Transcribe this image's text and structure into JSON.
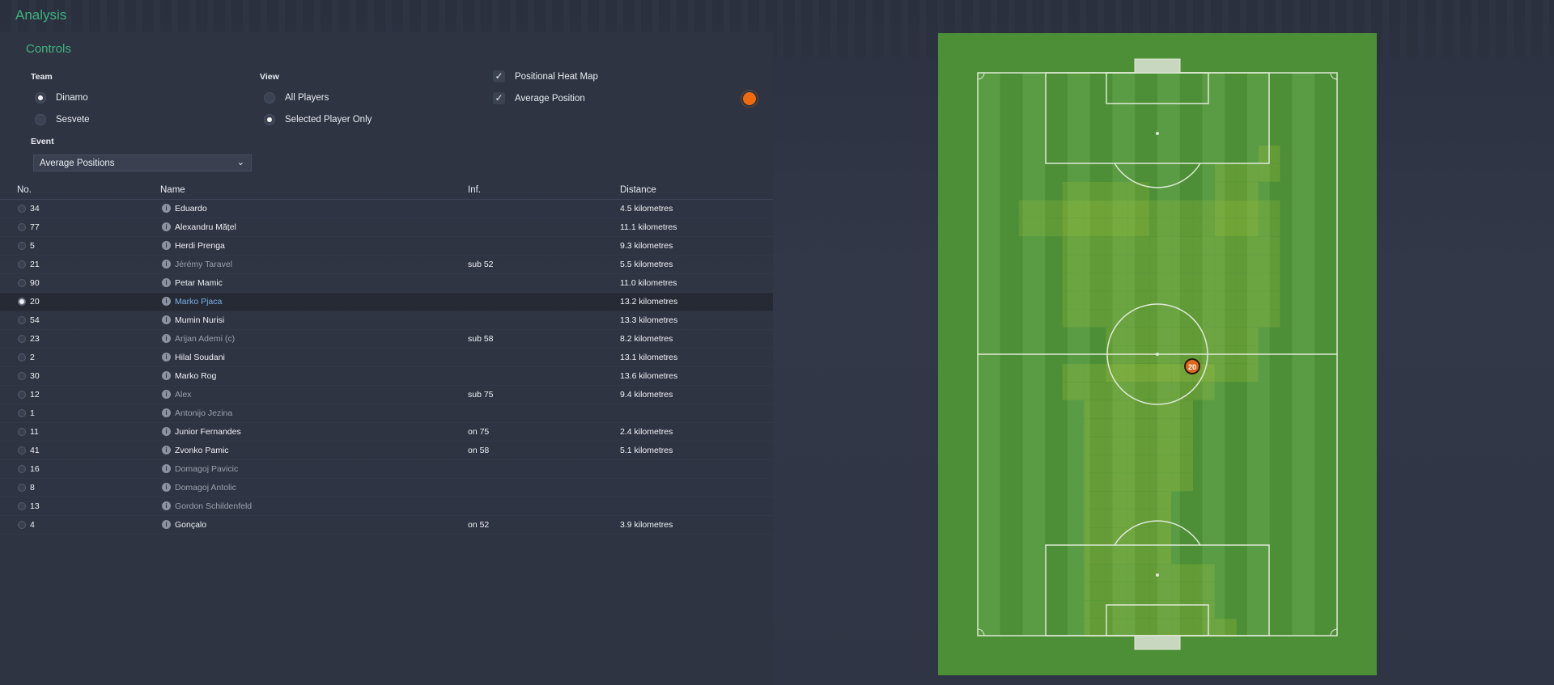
{
  "app_title": "Analysis",
  "controls": {
    "title": "Controls",
    "team_label": "Team",
    "teams": [
      {
        "label": "Dinamo",
        "selected": true
      },
      {
        "label": "Sesvete",
        "selected": false
      }
    ],
    "view_label": "View",
    "views": [
      {
        "label": "All Players",
        "selected": false
      },
      {
        "label": "Selected Player Only",
        "selected": true
      }
    ],
    "options": [
      {
        "label": "Positional Heat Map",
        "checked": true
      },
      {
        "label": "Average Position",
        "checked": true
      }
    ],
    "average_position_color": "#f06a0f",
    "event_label": "Event",
    "event_value": "Average Positions"
  },
  "table": {
    "headers": {
      "no": "No.",
      "name": "Name",
      "inf": "Inf.",
      "distance": "Distance"
    },
    "rows": [
      {
        "no": "34",
        "name": "Eduardo",
        "inf": "",
        "distance": "4.5 kilometres",
        "dim": false,
        "selected": false
      },
      {
        "no": "77",
        "name": "Alexandru Mățel",
        "inf": "",
        "distance": "11.1 kilometres",
        "dim": false,
        "selected": false
      },
      {
        "no": "5",
        "name": "Herdi Prenga",
        "inf": "",
        "distance": "9.3 kilometres",
        "dim": false,
        "selected": false
      },
      {
        "no": "21",
        "name": "Jérémy Taravel",
        "inf": "sub 52",
        "distance": "5.5 kilometres",
        "dim": true,
        "selected": false
      },
      {
        "no": "90",
        "name": "Petar Mamic",
        "inf": "",
        "distance": "11.0 kilometres",
        "dim": false,
        "selected": false
      },
      {
        "no": "20",
        "name": "Marko Pjaca",
        "inf": "",
        "distance": "13.2 kilometres",
        "dim": false,
        "selected": true
      },
      {
        "no": "54",
        "name": "Mumin Nurisi",
        "inf": "",
        "distance": "13.3 kilometres",
        "dim": false,
        "selected": false
      },
      {
        "no": "23",
        "name": "Arijan Ademi (c)",
        "inf": "sub 58",
        "distance": "8.2 kilometres",
        "dim": true,
        "selected": false
      },
      {
        "no": "2",
        "name": "Hilal Soudani",
        "inf": "",
        "distance": "13.1 kilometres",
        "dim": false,
        "selected": false
      },
      {
        "no": "30",
        "name": "Marko Rog",
        "inf": "",
        "distance": "13.6 kilometres",
        "dim": false,
        "selected": false
      },
      {
        "no": "12",
        "name": "Alex",
        "inf": "sub 75",
        "distance": "9.4 kilometres",
        "dim": true,
        "selected": false
      },
      {
        "no": "1",
        "name": "Antonijo Jezina",
        "inf": "",
        "distance": "",
        "dim": true,
        "selected": false
      },
      {
        "no": "11",
        "name": "Junior Fernandes",
        "inf": "on 75",
        "distance": "2.4 kilometres",
        "dim": false,
        "selected": false
      },
      {
        "no": "41",
        "name": "Zvonko Pamic",
        "inf": "on 58",
        "distance": "5.1 kilometres",
        "dim": false,
        "selected": false
      },
      {
        "no": "16",
        "name": "Domagoj Pavicic",
        "inf": "",
        "distance": "",
        "dim": true,
        "selected": false
      },
      {
        "no": "8",
        "name": "Domagoj Antolic",
        "inf": "",
        "distance": "",
        "dim": true,
        "selected": false
      },
      {
        "no": "13",
        "name": "Gordon Schildenfeld",
        "inf": "",
        "distance": "",
        "dim": true,
        "selected": false
      },
      {
        "no": "4",
        "name": "Gonçalo",
        "inf": "on 52",
        "distance": "3.9 kilometres",
        "dim": false,
        "selected": false
      }
    ]
  },
  "pitch": {
    "grass_color": "#4d8f36",
    "stripe_color": "#5a9c43",
    "line_color": "#dfe9d6",
    "heat_color": "#a6c23c",
    "player_marker": {
      "label": "20",
      "color": "#e2681c"
    }
  }
}
